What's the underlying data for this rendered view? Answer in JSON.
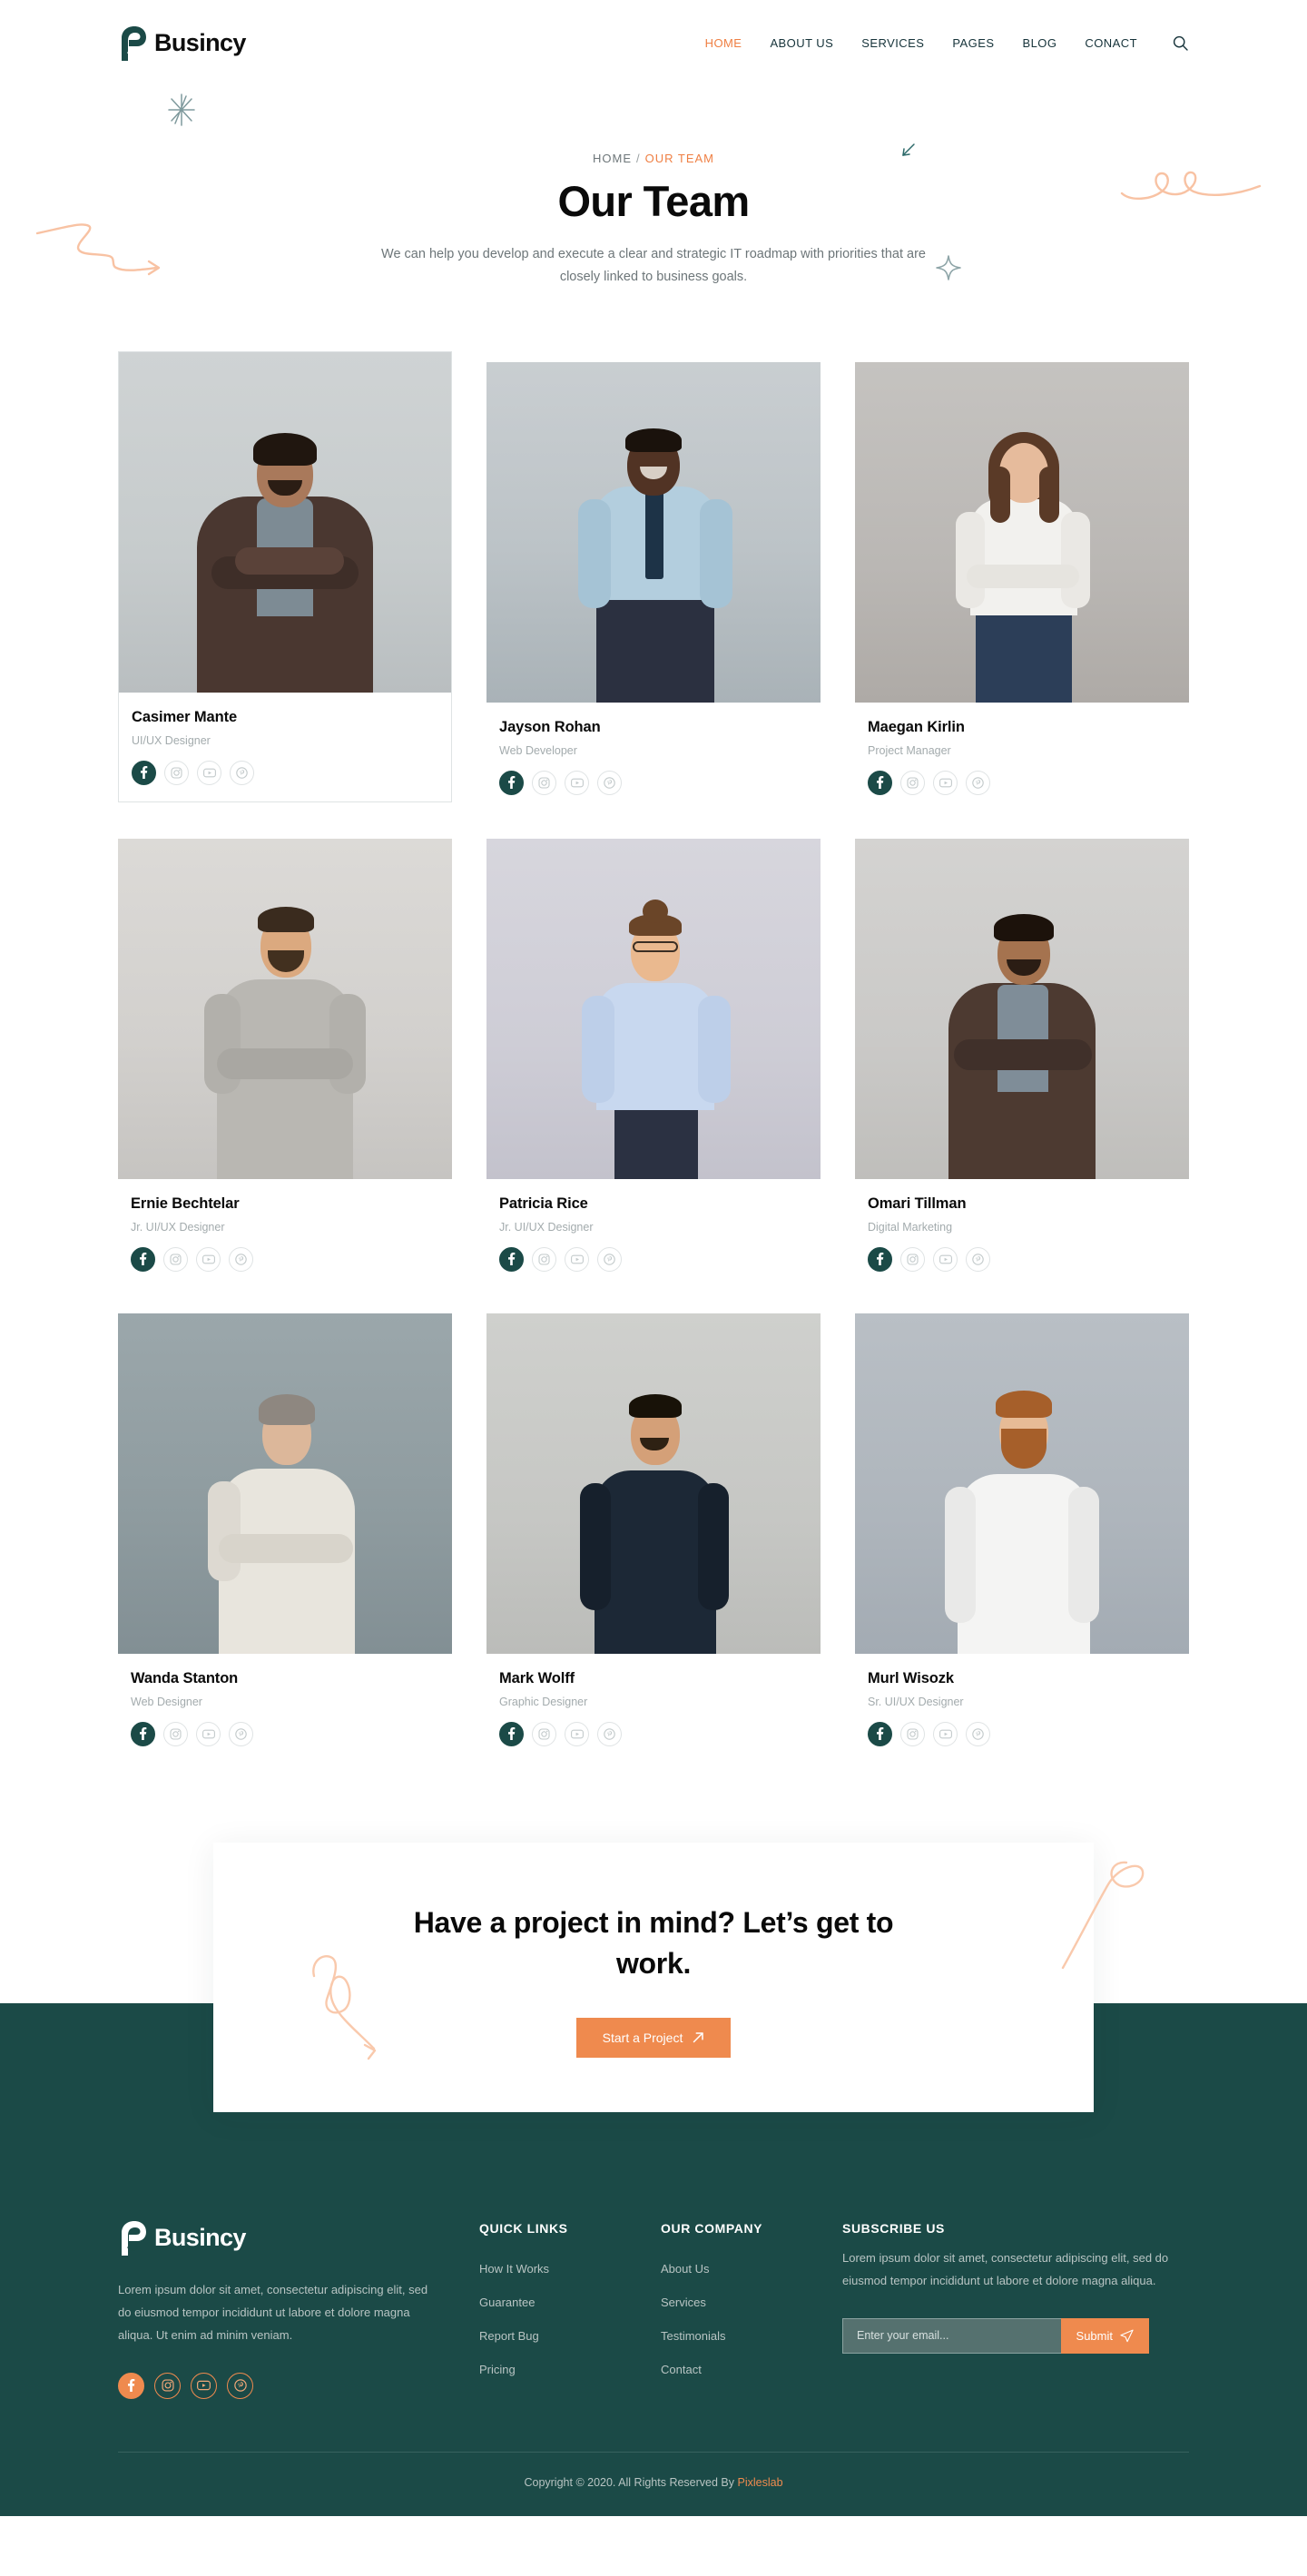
{
  "colors": {
    "teal": "#1b4a47",
    "orange": "#ef7f43",
    "orange_btn": "#ef8a4e",
    "muted": "#a3abad",
    "footer_text": "#b8c4c3"
  },
  "header": {
    "brand": "Busincy",
    "nav": [
      {
        "label": "HOME",
        "active": true
      },
      {
        "label": "ABOUT US",
        "active": false
      },
      {
        "label": "SERVICES",
        "active": false
      },
      {
        "label": "PAGES",
        "active": false
      },
      {
        "label": "BLOG",
        "active": false
      },
      {
        "label": "CONACT",
        "active": false
      }
    ],
    "search_icon": "search-icon"
  },
  "hero": {
    "breadcrumb_home": "HOME",
    "breadcrumb_sep": "/",
    "breadcrumb_current": "OUR TEAM",
    "title": "Our Team",
    "subtitle": "We can help you develop and execute a clear and strategic IT roadmap with priorities that are closely linked to business goals."
  },
  "team": {
    "social_labels": [
      "facebook-icon",
      "instagram-icon",
      "youtube-icon",
      "pinterest-icon"
    ],
    "members": [
      {
        "name": "Casimer Mante",
        "role": "UI/UX Designer"
      },
      {
        "name": "Jayson Rohan",
        "role": "Web Developer"
      },
      {
        "name": "Maegan Kirlin",
        "role": "Project Manager"
      },
      {
        "name": "Ernie Bechtelar",
        "role": "Jr. UI/UX Designer"
      },
      {
        "name": "Patricia Rice",
        "role": "Jr. UI/UX Designer"
      },
      {
        "name": "Omari Tillman",
        "role": "Digital Marketing"
      },
      {
        "name": "Wanda Stanton",
        "role": "Web Designer"
      },
      {
        "name": "Mark Wolff",
        "role": "Graphic Designer"
      },
      {
        "name": "Murl Wisozk",
        "role": "Sr. UI/UX Designer"
      }
    ]
  },
  "cta": {
    "heading": "Have a project in mind? Let’s get to work.",
    "button": "Start a Project"
  },
  "footer": {
    "brand": "Busincy",
    "about": "Lorem ipsum dolor sit amet, consectetur adipiscing elit, sed do eiusmod tempor incididunt ut labore et dolore magna aliqua. Ut enim ad minim veniam.",
    "socials": [
      "facebook-icon",
      "instagram-icon",
      "youtube-icon",
      "pinterest-icon"
    ],
    "quick_links": {
      "title": "QUICK LINKS",
      "items": [
        "How It Works",
        "Guarantee",
        "Report Bug",
        "Pricing"
      ]
    },
    "company": {
      "title": "OUR COMPANY",
      "items": [
        "About Us",
        "Services",
        "Testimonials",
        "Contact"
      ]
    },
    "subscribe": {
      "title": "SUBSCRIBE US",
      "text": "Lorem ipsum dolor sit amet, consectetur adipiscing elit, sed do eiusmod tempor incididunt ut labore et dolore magna aliqua.",
      "placeholder": "Enter your email...",
      "button": "Submit"
    },
    "copyright_prefix": "Copyright © 2020. All Rights Reserved By ",
    "copyright_brand": "Pixleslab"
  }
}
